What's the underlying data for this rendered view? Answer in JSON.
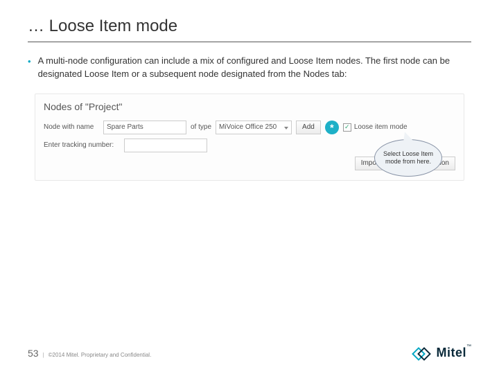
{
  "title": "… Loose Item mode",
  "bullet": "A multi-node configuration can include a mix of configured and Loose Item nodes. The first node can be designated Loose Item or a subsequent node designated from the Nodes tab:",
  "shot": {
    "heading": "Nodes of \"Project\"",
    "node_with_name_label": "Node with name",
    "name_value": "Spare Parts",
    "of_type_label": "of type",
    "type_value": "MiVoice Office 250",
    "add_label": "Add",
    "burst": "*",
    "loose_item_label": "Loose item mode",
    "tracking_label": "Enter tracking number:",
    "import_label": "Import existing Configuration"
  },
  "callout": "Select Loose Item mode from here.",
  "footer": {
    "page": "53",
    "sep": "|",
    "copyright": "©2014 Mitel. Proprietary and Confidential.",
    "brand": "Mitel",
    "tm": "™"
  }
}
